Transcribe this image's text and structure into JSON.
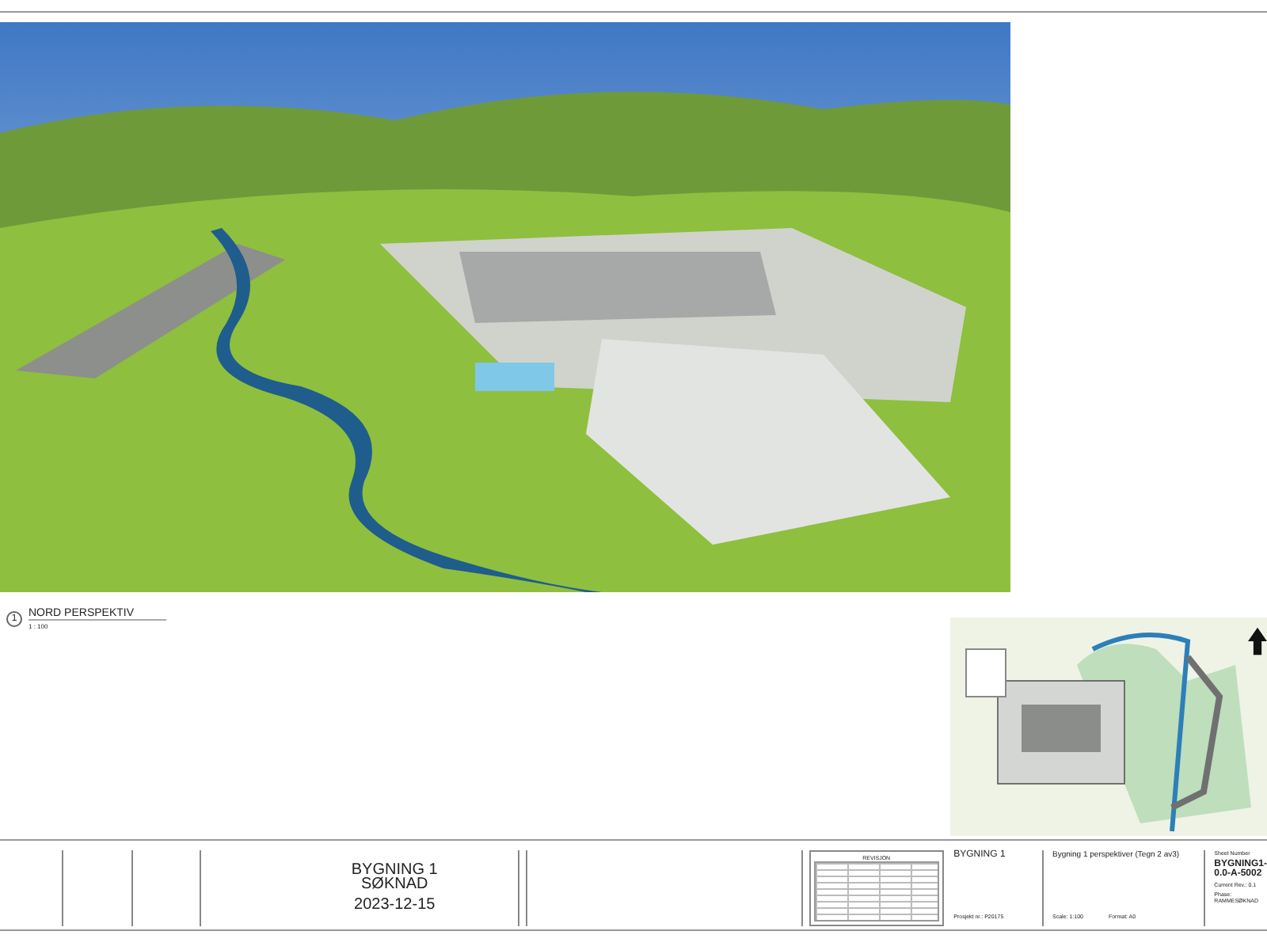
{
  "view": {
    "number": "1",
    "title": "NORD PERSPEKTIV",
    "scale": "1 : 100"
  },
  "title_block": {
    "building": "BYGNING 1",
    "stage": "SØKNAD",
    "date": "2023-12-15",
    "revision": {
      "title": "REVISJON"
    },
    "project": {
      "name": "BYGNING 1",
      "number": "Prosjekt nr.: P20175"
    },
    "drawing": {
      "title": "Bygning 1 perspektiver (Tegn 2 av3)",
      "scale": "Scale: 1:100",
      "format": "Format: A0"
    },
    "sheet": {
      "label": "Sheet Number",
      "number": "BYGNING1-0.0-A-5002",
      "current_rev": "Current Rev.: 0.1",
      "phase": "Phase: RAMMESØKNAD"
    }
  }
}
